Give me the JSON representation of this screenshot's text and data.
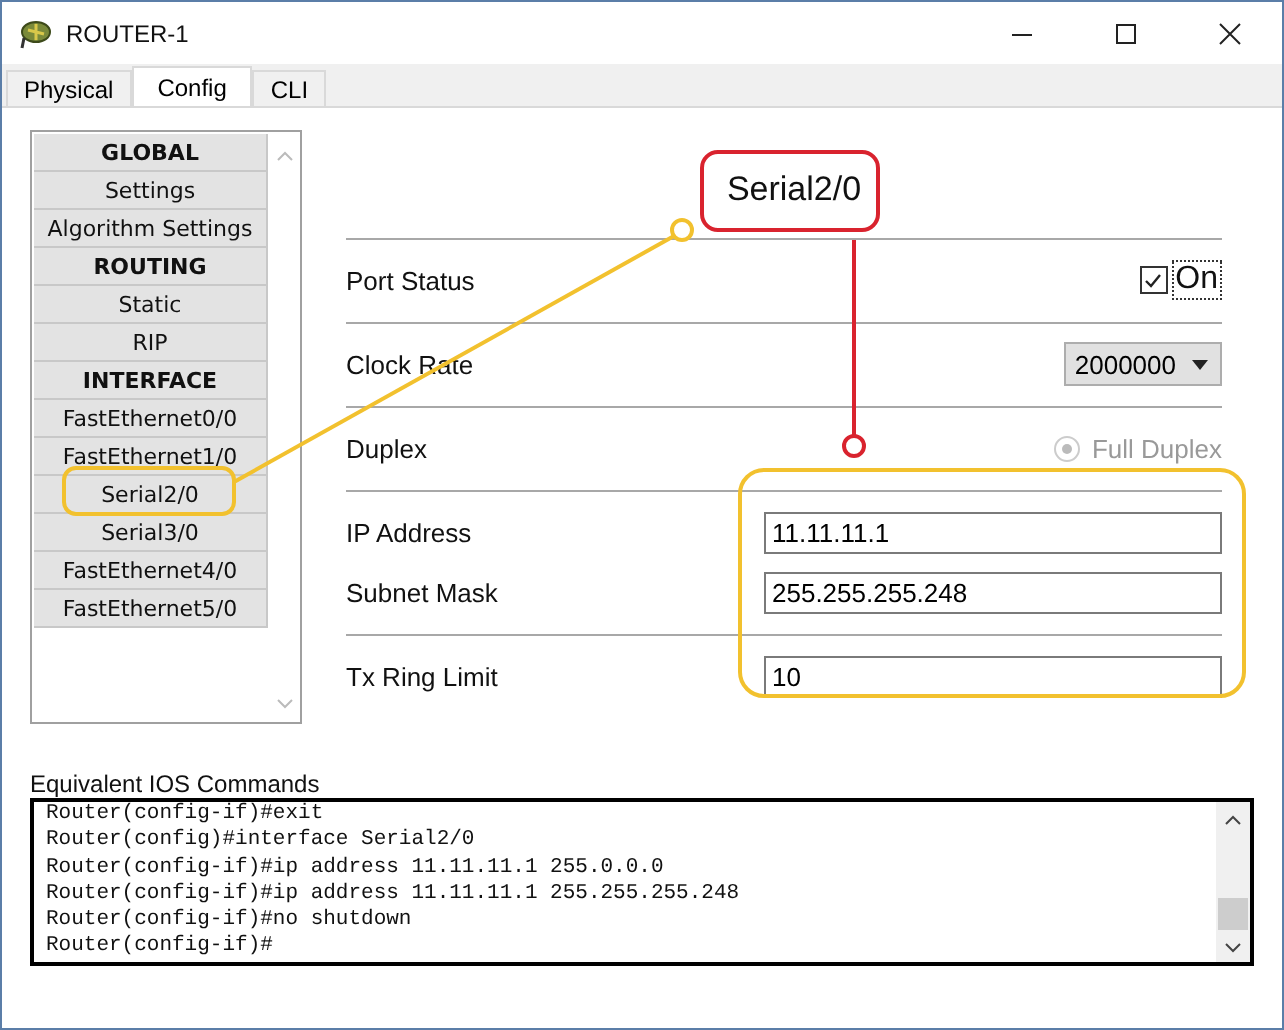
{
  "window": {
    "title": "ROUTER-1"
  },
  "tabs": [
    {
      "label": "Physical",
      "selected": false
    },
    {
      "label": "Config",
      "selected": true
    },
    {
      "label": "CLI",
      "selected": false
    }
  ],
  "sidebar": {
    "items": [
      {
        "label": "GLOBAL",
        "kind": "header"
      },
      {
        "label": "Settings",
        "kind": "item"
      },
      {
        "label": "Algorithm Settings",
        "kind": "item"
      },
      {
        "label": "ROUTING",
        "kind": "header"
      },
      {
        "label": "Static",
        "kind": "item"
      },
      {
        "label": "RIP",
        "kind": "item"
      },
      {
        "label": "INTERFACE",
        "kind": "header"
      },
      {
        "label": "FastEthernet0/0",
        "kind": "item"
      },
      {
        "label": "FastEthernet1/0",
        "kind": "item"
      },
      {
        "label": "Serial2/0",
        "kind": "item"
      },
      {
        "label": "Serial3/0",
        "kind": "item"
      },
      {
        "label": "FastEthernet4/0",
        "kind": "item"
      },
      {
        "label": "FastEthernet5/0",
        "kind": "item"
      }
    ]
  },
  "panel": {
    "title": "Serial2/0",
    "groups": [
      [
        {
          "kind": "checkbox",
          "label": "Port Status",
          "option": "On",
          "checked": true
        }
      ],
      [
        {
          "kind": "select",
          "label": "Clock Rate",
          "value": "2000000"
        }
      ],
      [
        {
          "kind": "radio",
          "label": "Duplex",
          "option": "Full Duplex",
          "checked": true,
          "disabled": true
        }
      ],
      [
        {
          "kind": "text",
          "label": "IP Address",
          "value": "11.11.11.1"
        },
        {
          "kind": "text",
          "label": "Subnet Mask",
          "value": "255.255.255.248"
        }
      ],
      [
        {
          "kind": "text",
          "label": "Tx Ring Limit",
          "value": "10"
        }
      ]
    ]
  },
  "console": {
    "label": "Equivalent IOS Commands",
    "lines": [
      "Router(config-if)#exit",
      "Router(config)#interface Serial2/0",
      "Router(config-if)#ip address 11.11.11.1 255.0.0.0",
      "Router(config-if)#ip address 11.11.11.1 255.255.255.248",
      "Router(config-if)#no shutdown",
      "Router(config-if)#"
    ]
  }
}
